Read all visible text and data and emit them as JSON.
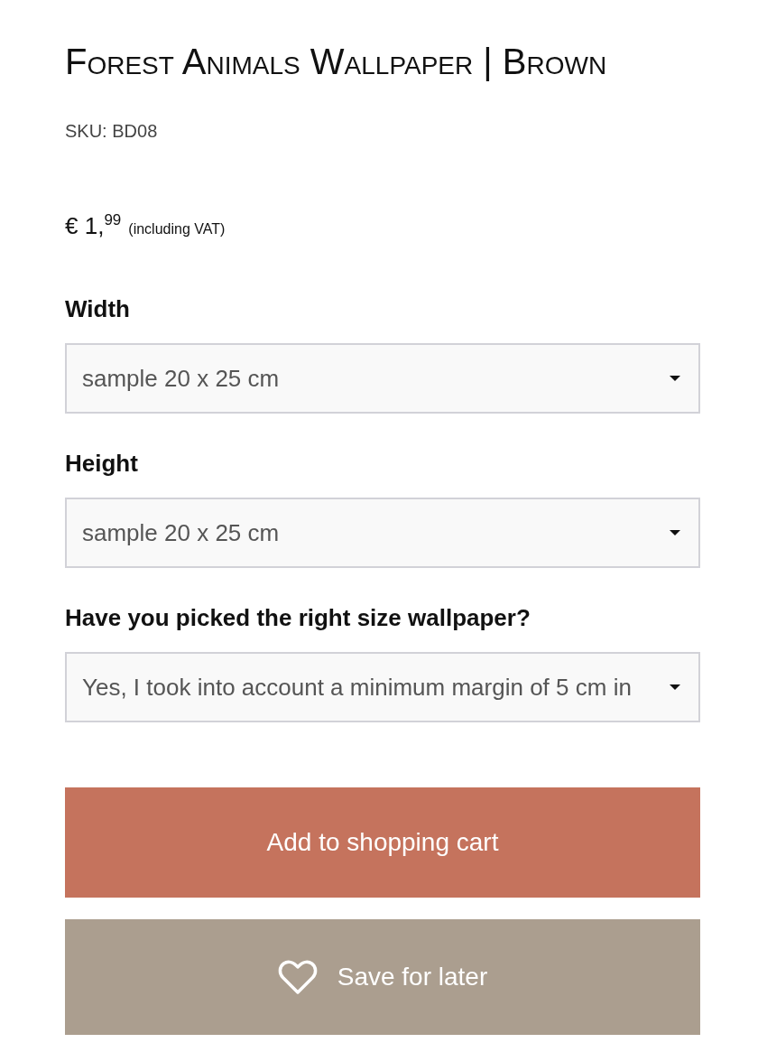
{
  "product": {
    "title": "Forest Animals Wallpaper | Brown",
    "sku": "SKU: BD08"
  },
  "price": {
    "amount": "€ 1,$^{99}$",
    "note": "(including VAT)"
  },
  "options": [
    {
      "label": "Width",
      "value": "sample 20 x 25 cm"
    },
    {
      "label": "Height",
      "value": "sample 20 x 25 cm"
    },
    {
      "label": "Have you picked the right size wallpaper?",
      "value": "Yes, I took into account a minimum margin of 5 cm in"
    }
  ],
  "buttons": [
    {
      "kind": "primary",
      "label": "Add to shopping cart"
    },
    {
      "kind": "secondary",
      "label": "Save for later"
    }
  ]
}
